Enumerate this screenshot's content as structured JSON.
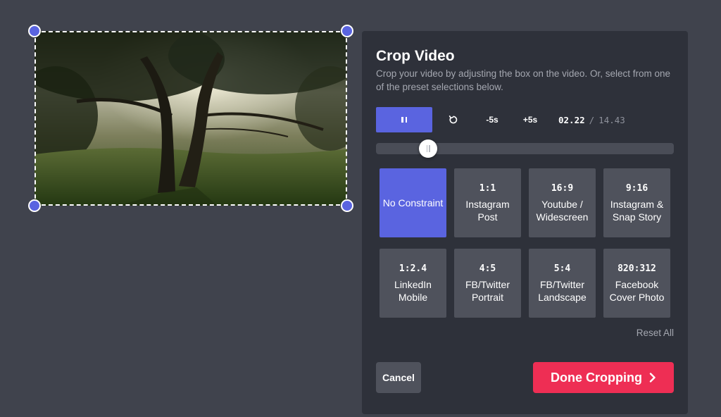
{
  "panel": {
    "title": "Crop Video",
    "description": "Crop your video by adjusting the box on the video. Or, select from one of the preset selections below."
  },
  "player": {
    "play_state_icon": "pause-icon",
    "rewind_icon": "rotate-left-icon",
    "back_label": "-5s",
    "forward_label": "+5s",
    "current_time": "02.22",
    "separator": "/",
    "duration": "14.43",
    "progress_fraction": 0.154
  },
  "presets": [
    {
      "ratio": "",
      "label": "No Constraint",
      "active": true
    },
    {
      "ratio": "1:1",
      "label": "Instagram Post",
      "active": false
    },
    {
      "ratio": "16:9",
      "label": "Youtube / Widescreen",
      "active": false
    },
    {
      "ratio": "9:16",
      "label": "Instagram & Snap Story",
      "active": false
    },
    {
      "ratio": "1:2.4",
      "label": "LinkedIn Mobile",
      "active": false
    },
    {
      "ratio": "4:5",
      "label": "FB/Twitter Portrait",
      "active": false
    },
    {
      "ratio": "5:4",
      "label": "FB/Twitter Landscape",
      "active": false
    },
    {
      "ratio": "820:312",
      "label": "Facebook Cover Photo",
      "active": false
    }
  ],
  "actions": {
    "reset_label": "Reset All",
    "cancel_label": "Cancel",
    "done_label": "Done Cropping"
  },
  "colors": {
    "accent": "#5a64e0",
    "primary_action": "#ee2e54",
    "panel_bg": "#2e313a",
    "page_bg": "#40434d"
  }
}
